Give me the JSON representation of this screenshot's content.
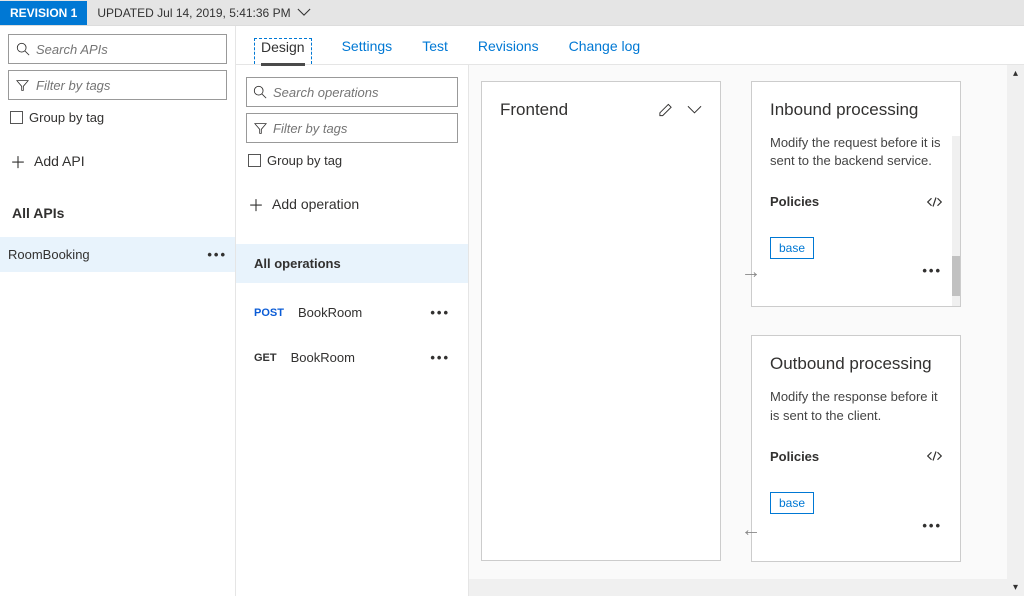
{
  "topbar": {
    "revision_label": "REVISION 1",
    "updated_text": "UPDATED Jul 14, 2019, 5:41:36 PM"
  },
  "sidebar": {
    "search_placeholder": "Search APIs",
    "filter_placeholder": "Filter by tags",
    "group_label": "Group by tag",
    "add_api_label": "Add API",
    "all_apis_label": "All APIs",
    "api_items": [
      {
        "name": "RoomBooking"
      }
    ]
  },
  "tabs": [
    {
      "label": "Design",
      "active": true
    },
    {
      "label": "Settings"
    },
    {
      "label": "Test"
    },
    {
      "label": "Revisions"
    },
    {
      "label": "Change log"
    }
  ],
  "operations_panel": {
    "search_placeholder": "Search operations",
    "filter_placeholder": "Filter by tags",
    "group_label": "Group by tag",
    "add_op_label": "Add operation",
    "all_ops_label": "All operations",
    "ops": [
      {
        "verb": "POST",
        "name": "BookRoom"
      },
      {
        "verb": "GET",
        "name": "BookRoom"
      }
    ]
  },
  "canvas": {
    "frontend": {
      "title": "Frontend"
    },
    "inbound": {
      "title": "Inbound processing",
      "desc": "Modify the request before it is sent to the backend service.",
      "policies_label": "Policies",
      "base_label": "base"
    },
    "outbound": {
      "title": "Outbound processing",
      "desc": "Modify the response before it is sent to the client.",
      "policies_label": "Policies",
      "base_label": "base"
    }
  }
}
